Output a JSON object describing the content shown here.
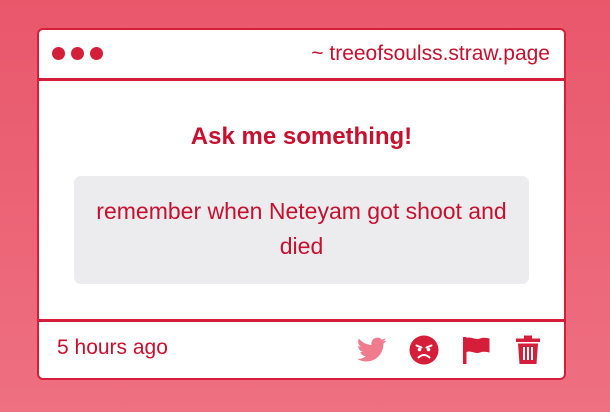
{
  "window": {
    "url": "~ treeofsoulss.straw.page"
  },
  "main": {
    "heading": "Ask me something!",
    "question": "remember when Neteyam got shoot and died"
  },
  "footer": {
    "timestamp": "5 hours ago",
    "actions": [
      {
        "icon": "twitter-icon",
        "color": "#f07b8d"
      },
      {
        "icon": "angry-face-icon",
        "color": "#d51f3a"
      },
      {
        "icon": "flag-icon",
        "color": "#d51f3a"
      },
      {
        "icon": "trash-icon",
        "color": "#d51f3a"
      }
    ]
  },
  "colors": {
    "accent": "#d51f3a",
    "text": "#c8102e",
    "question_bg": "#ececee",
    "background_top": "#e9576b",
    "background_bottom": "#ee7081"
  }
}
